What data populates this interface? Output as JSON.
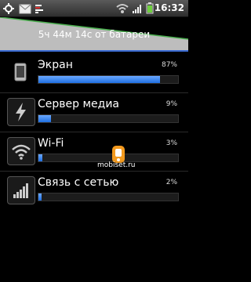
{
  "status_bar": {
    "time": "16:32",
    "icons": [
      "usb-debug-icon",
      "mail-icon",
      "battery-usage-icon",
      "wifi-icon",
      "signal-icon",
      "battery-icon"
    ]
  },
  "battery_graph": {
    "caption": "5ч 44м 14с от батареи"
  },
  "usage_items": [
    {
      "label": "Экран",
      "percent": "87%",
      "fraction": 0.87,
      "icon": "screen-icon"
    },
    {
      "label": "Сервер медиа",
      "percent": "9%",
      "fraction": 0.09,
      "icon": "lightning-icon"
    },
    {
      "label": "Wi-Fi",
      "percent": "3%",
      "fraction": 0.03,
      "icon": "wifi-icon"
    },
    {
      "label": "Связь с сетью",
      "percent": "2%",
      "fraction": 0.02,
      "icon": "cell-signal-icon"
    }
  ],
  "watermark": {
    "text": "mobiset.ru"
  },
  "colors": {
    "bar_fill": "#1f6fe0",
    "graph_line": "#3a6bd1"
  }
}
